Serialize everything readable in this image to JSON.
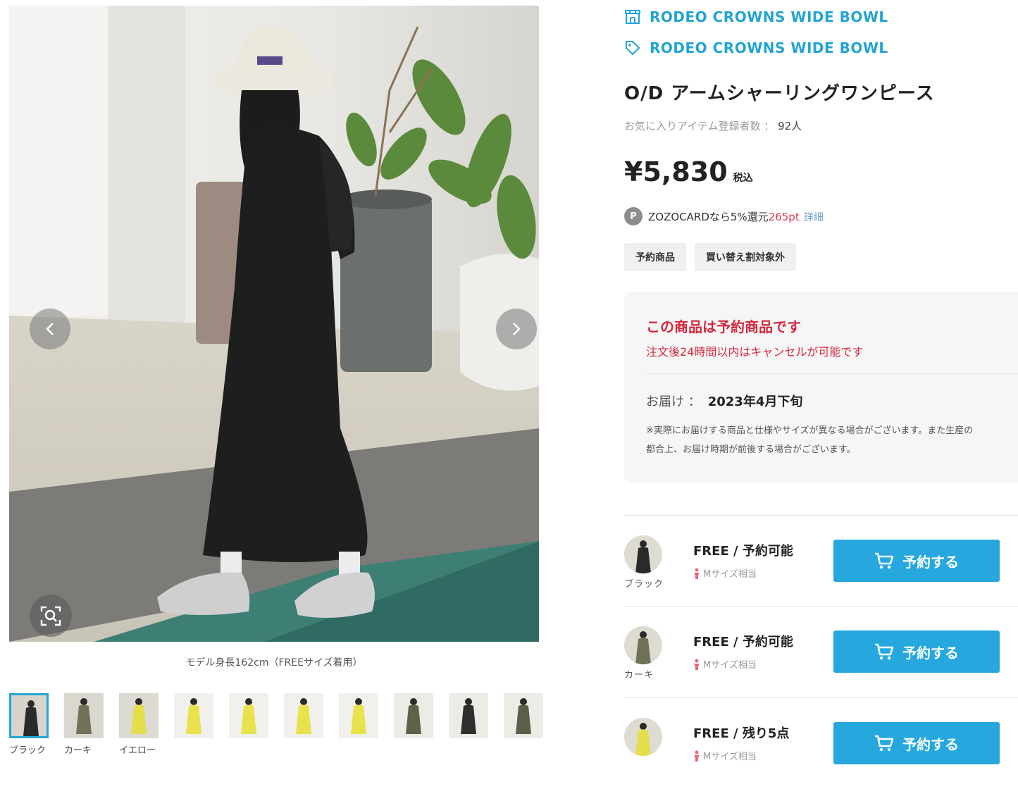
{
  "gallery": {
    "caption": "モデル身長162cm（FREEサイズ着用）",
    "thumbnails": [
      {
        "label": "ブラック",
        "color": "#2a2a2a",
        "bg": "#d8d4cc"
      },
      {
        "label": "カーキ",
        "color": "#6f7257",
        "bg": "#d9d7cf"
      },
      {
        "label": "イエロー",
        "color": "#e2df4a",
        "bg": "#dcdad3"
      },
      {
        "label": "",
        "color": "#e8e24c",
        "bg": "#f1f0ec"
      },
      {
        "label": "",
        "color": "#e8e24c",
        "bg": "#f1f0ec"
      },
      {
        "label": "",
        "color": "#e8e24c",
        "bg": "#f1f0ec"
      },
      {
        "label": "",
        "color": "#e8e24c",
        "bg": "#f1f0ec"
      },
      {
        "label": "",
        "color": "#5c6348",
        "bg": "#ecebe6"
      },
      {
        "label": "",
        "color": "#2f2f2f",
        "bg": "#ecebe6"
      },
      {
        "label": "",
        "color": "#5a5f4a",
        "bg": "#ecebe6"
      }
    ]
  },
  "brand": {
    "shop_name": "RODEO CROWNS WIDE BOWL",
    "brand_name": "RODEO CROWNS WIDE BOWL"
  },
  "product": {
    "title": "O/D アームシャーリングワンピース",
    "favorites_label": "お気に入りアイテム登録者数 ：",
    "favorites_count": "92人",
    "price": "¥5,830",
    "tax_label": "税込"
  },
  "points": {
    "badge": "P",
    "text_pre": "ZOZOCARDなら5%還元",
    "pts": "265pt",
    "detail": "詳細"
  },
  "tags": [
    "予約商品",
    "買い替え割対象外"
  ],
  "notice": {
    "title": "この商品は予約商品です",
    "subtitle": "注文後24時間以内はキャンセルが可能です",
    "delivery_label": "お届け ：",
    "delivery_value": "2023年4月下旬",
    "note_line1": "※実際にお届けする商品と仕様やサイズが異なる場合がございます。また生産の",
    "note_line2": "都合上、お届け時期が前後する場合がございます。"
  },
  "sizes": [
    {
      "color_label": "ブラック",
      "size": "FREE",
      "sep": "/",
      "status": "予約可能",
      "hint": "Mサイズ相当",
      "button": "予約する",
      "swatch": "#2a2a2a"
    },
    {
      "color_label": "カーキ",
      "size": "FREE",
      "sep": "/",
      "status": "予約可能",
      "hint": "Mサイズ相当",
      "button": "予約する",
      "swatch": "#6f7257"
    },
    {
      "color_label": "",
      "size": "FREE",
      "sep": "/",
      "status": "残り5点",
      "hint": "Mサイズ相当",
      "button": "予約する",
      "swatch": "#e2df4a"
    }
  ],
  "colors": {
    "accent": "#24a3d4",
    "button": "#26a8df",
    "alert": "#d3283d"
  }
}
